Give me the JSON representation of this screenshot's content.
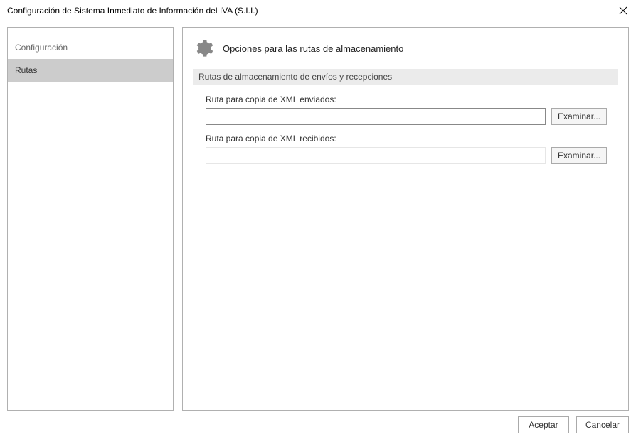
{
  "window": {
    "title": "Configuración de Sistema Inmediato de Información del IVA (S.I.I.)"
  },
  "sidebar": {
    "items": [
      {
        "label": "Configuración",
        "selected": false
      },
      {
        "label": "Rutas",
        "selected": true
      }
    ]
  },
  "panel": {
    "title": "Opciones para las rutas de almacenamiento",
    "section_header": "Rutas de almacenamiento de envíos y recepciones",
    "fields": {
      "sent": {
        "label": "Ruta para copia de XML enviados:",
        "value": "",
        "browse": "Examinar..."
      },
      "received": {
        "label": "Ruta para copia de XML recibidos:",
        "value": "",
        "browse": "Examinar..."
      }
    }
  },
  "footer": {
    "accept": "Aceptar",
    "cancel": "Cancelar"
  }
}
